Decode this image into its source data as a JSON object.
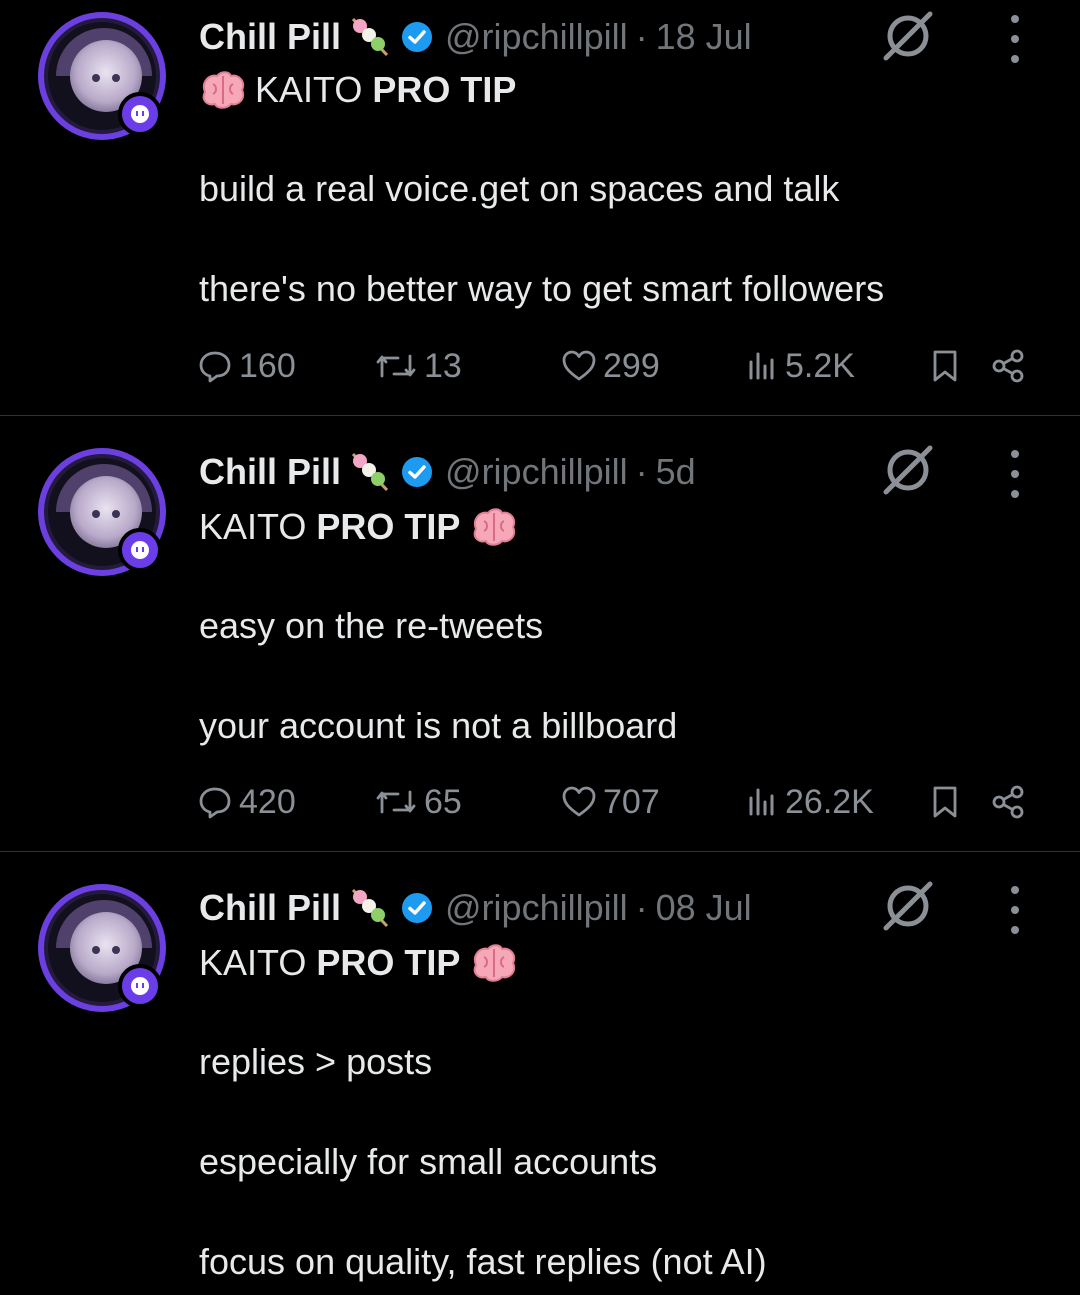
{
  "tweets": [
    {
      "name": "Chill Pill",
      "handle": "@ripchillpill",
      "separator": "·",
      "time": "18 Jul",
      "title_plain": "KAITO",
      "title_bold": "PRO TIP",
      "brain_position": "before",
      "lines": [
        "build a real voice.get on spaces and talk",
        "there's no better way to get smart followers"
      ],
      "stats": {
        "replies": "160",
        "reposts": "13",
        "likes": "299",
        "views": "5.2K"
      }
    },
    {
      "name": "Chill Pill",
      "handle": "@ripchillpill",
      "separator": "·",
      "time": "5d",
      "title_plain": "KAITO",
      "title_bold": "PRO TIP",
      "brain_position": "after",
      "lines": [
        "easy on the re-tweets",
        "your account is not a billboard"
      ],
      "stats": {
        "replies": "420",
        "reposts": "65",
        "likes": "707",
        "views": "26.2K"
      }
    },
    {
      "name": "Chill Pill",
      "handle": "@ripchillpill",
      "separator": "·",
      "time": "08 Jul",
      "title_plain": "KAITO",
      "title_bold": "PRO TIP",
      "brain_position": "after",
      "lines": [
        "replies > posts",
        "especially for small accounts",
        "focus on quality, fast replies (not AI)"
      ]
    }
  ],
  "colors": {
    "background": "#000000",
    "text": "#e7e9ea",
    "muted": "#71767b",
    "verified": "#1d9bf0",
    "avatar_ring": "#6b3fe0"
  },
  "icons": [
    "verified-badge-icon",
    "dango-emoji-icon",
    "brain-emoji-icon",
    "grok-icon",
    "more-icon",
    "reply-icon",
    "repost-icon",
    "like-icon",
    "views-icon",
    "bookmark-icon",
    "share-icon"
  ]
}
